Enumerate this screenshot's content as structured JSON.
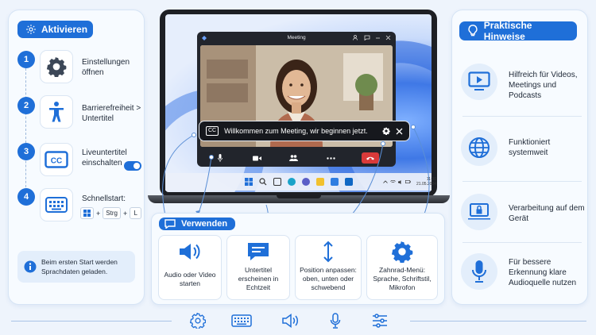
{
  "left_panel": {
    "title": "Aktivieren",
    "steps": [
      {
        "number": "1",
        "icon": "gear-icon",
        "text": "Einstellungen öffnen"
      },
      {
        "number": "2",
        "icon": "accessibility-icon",
        "text": "Barrierefreiheit > Untertitel"
      },
      {
        "number": "3",
        "icon": "closed-caption-icon",
        "text": "Liveuntertitel einschalten",
        "toggle_on": true
      },
      {
        "number": "4",
        "icon": "keyboard-icon",
        "text": "Schnellstart:",
        "shortcut": {
          "keys": [
            "Strg",
            "L"
          ],
          "plus": "+"
        }
      }
    ],
    "info": "Beim ersten Start werden Sprachdaten geladen."
  },
  "laptop": {
    "meeting_title": "Meeting",
    "caption_cc": "CC",
    "caption_text": "Willkommen zum Meeting, wir beginnen jetzt.",
    "clock_time": "11:30",
    "clock_date": "21.05.2024"
  },
  "usage": {
    "title": "Verwenden",
    "cards": [
      {
        "icon": "speaker-icon",
        "label": "Audio oder Video starten"
      },
      {
        "icon": "caption-message-icon",
        "label": "Untertitel erscheinen in Echtzeit"
      },
      {
        "icon": "move-arrows-icon",
        "label": "Position anpassen: oben, unten oder schwebend"
      },
      {
        "icon": "gear-icon",
        "label": "Zahnrad-Menü: Sprache, Schriftstil, Mikrofon"
      }
    ]
  },
  "right_panel": {
    "title": "Praktische Hinweise",
    "hints": [
      {
        "icon": "video-play-icon",
        "text": "Hilfreich für Videos, Meetings und Podcasts"
      },
      {
        "icon": "globe-icon",
        "text": "Funktioniert systemweit"
      },
      {
        "icon": "laptop-lock-icon",
        "text": "Verarbeitung auf dem Gerät"
      },
      {
        "icon": "microphone-icon",
        "text": "Für bessere Erkennung klare Audioquelle nutzen"
      }
    ]
  },
  "bottom_bar": {
    "icons": [
      "gear-icon",
      "keyboard-icon",
      "speaker-icon",
      "microphone-icon",
      "sliders-icon"
    ]
  },
  "colors": {
    "accent": "#1f6fd8",
    "background": "#eef4fc",
    "end_call": "#d93a3a"
  }
}
